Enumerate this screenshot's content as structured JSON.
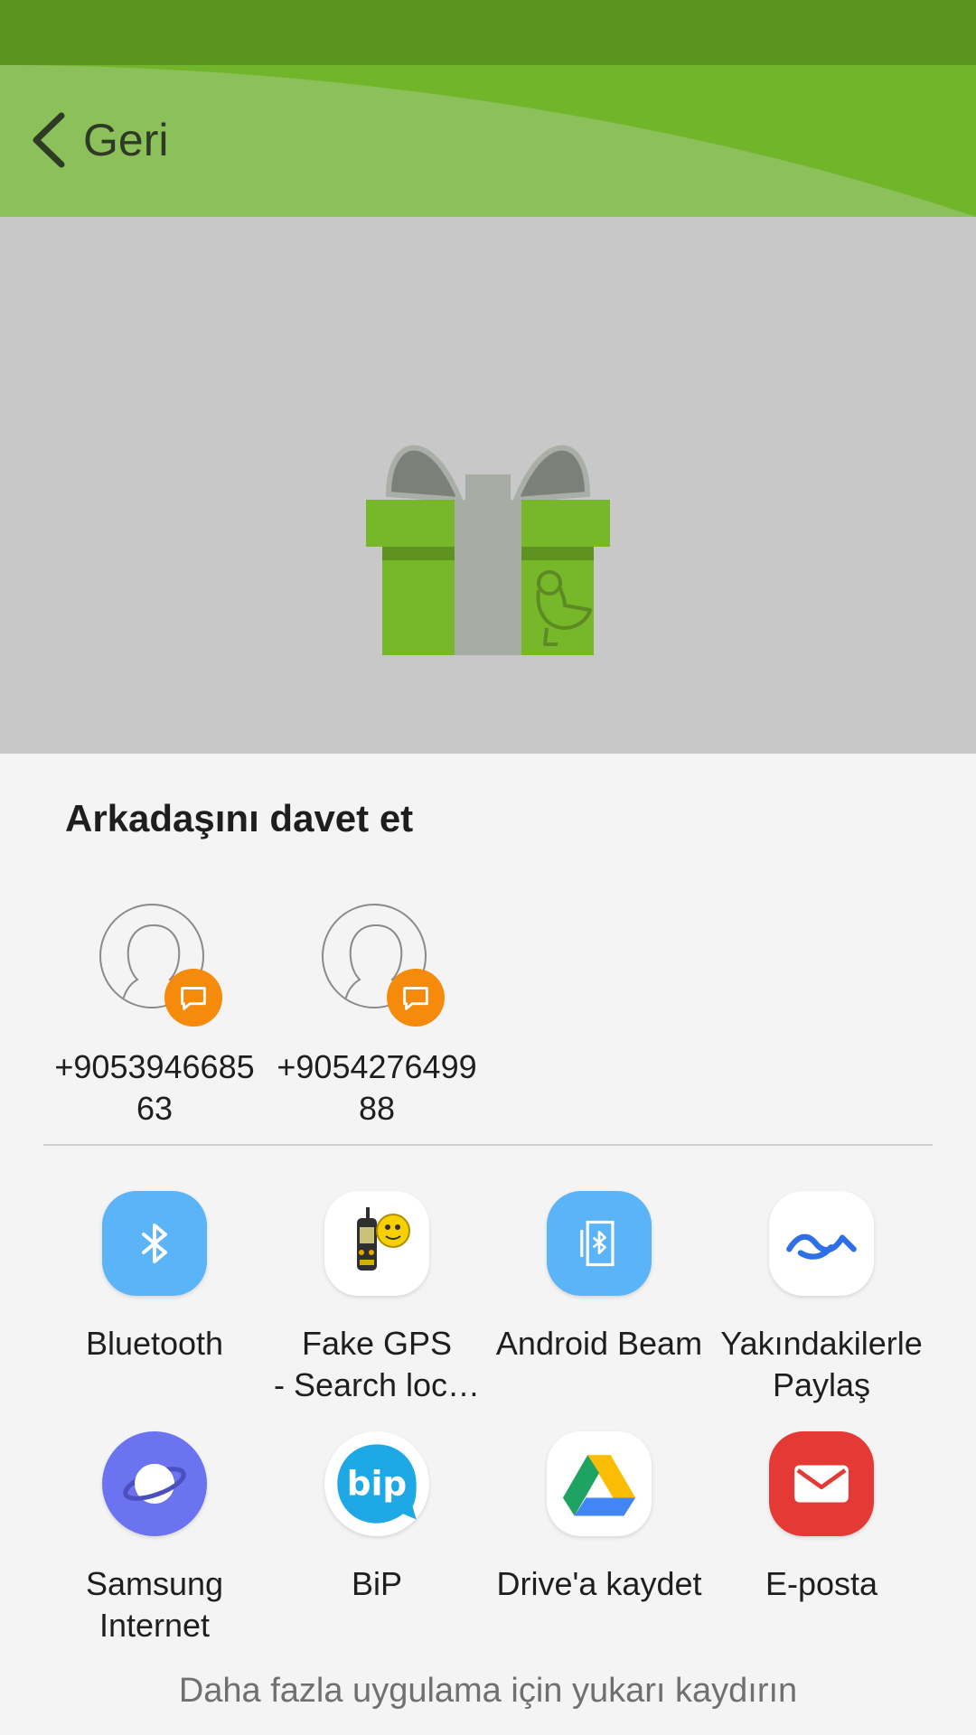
{
  "header": {
    "back_label": "Geri"
  },
  "sheet": {
    "title": "Arkadaşını davet et",
    "contacts": [
      {
        "number": "+905394668563"
      },
      {
        "number": "+905427649988"
      }
    ],
    "apps": [
      {
        "label": "Bluetooth"
      },
      {
        "label": "Fake GPS\n- Search loc…"
      },
      {
        "label": "Android Beam"
      },
      {
        "label": "Yakındakilerle\nPaylaş"
      },
      {
        "label": "Samsung\nInternet"
      },
      {
        "label": "BiP"
      },
      {
        "label": "Drive'a kaydet"
      },
      {
        "label": "E-posta"
      }
    ],
    "hint": "Daha fazla uygulama için yukarı kaydırın"
  },
  "colors": {
    "status_bar": "#5a941f",
    "app_bar": "#71b62a",
    "hero_background": "#c8c8c8",
    "badge": "#f58a0b",
    "bluetooth": "#5bb4f8",
    "samsung_internet": "#6c73f0",
    "email": "#e53935"
  }
}
